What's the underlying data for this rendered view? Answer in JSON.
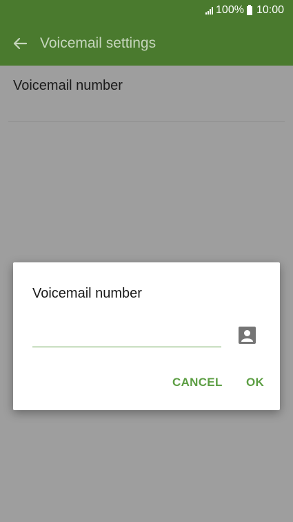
{
  "status_bar": {
    "battery_text": "100%",
    "time": "10:00"
  },
  "app_bar": {
    "back_icon": "back-arrow-icon",
    "title": "Voicemail settings"
  },
  "settings": {
    "item_label": "Voicemail number"
  },
  "dialog": {
    "title": "Voicemail number",
    "input_value": "",
    "input_placeholder": "",
    "contact_icon": "contact-icon",
    "cancel_label": "CANCEL",
    "ok_label": "OK"
  },
  "colors": {
    "app_bar": "#4a7a2e",
    "accent": "#5c9e43",
    "scrim": "#9e9e9e"
  }
}
